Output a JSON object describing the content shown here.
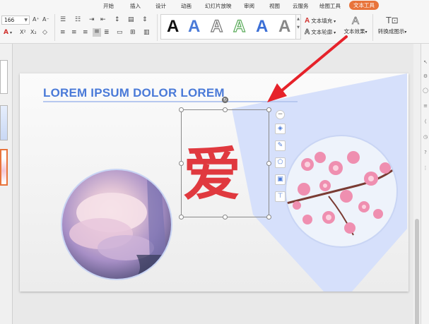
{
  "menu": {
    "items": [
      "开始",
      "插入",
      "设计",
      "动画",
      "幻灯片放映",
      "审阅",
      "视图",
      "云服务",
      "绘图工具"
    ],
    "active": "文本工具"
  },
  "ribbon": {
    "font_size": "166",
    "font_color_label": "A",
    "superscript": "X²",
    "subscript": "X₂",
    "clear_format": "◇",
    "gallery_letter": "A",
    "text_fill_label": "文本填充",
    "text_outline_label": "文本轮廓",
    "text_effect_label": "文本效果",
    "convert_label": "转换成图示"
  },
  "slide": {
    "title": "LOREM IPSUM DOLOR LOREM",
    "big_text": "爱"
  },
  "colors": {
    "accent": "#e8743b",
    "title_blue": "#4a7ad8",
    "text_red": "#e0393f",
    "arrow_red": "#e6222a"
  }
}
